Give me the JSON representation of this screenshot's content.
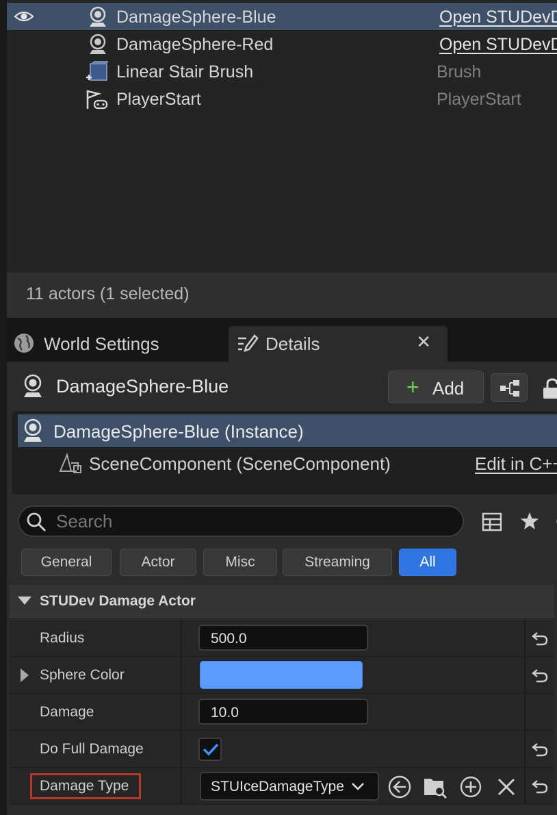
{
  "outliner": {
    "rows": [
      {
        "name": "DamageSphere-Blue",
        "type": "Open STUDevD",
        "selected": true,
        "visible": true
      },
      {
        "name": "DamageSphere-Red",
        "type": "Open STUDevD",
        "selected": false
      },
      {
        "name": "Linear Stair Brush",
        "type": "Brush",
        "selected": false
      },
      {
        "name": "PlayerStart",
        "type": "PlayerStart",
        "selected": false
      }
    ],
    "status": "11 actors (1 selected)"
  },
  "tabs": {
    "world_settings": "World Settings",
    "details": "Details",
    "close": "✕"
  },
  "details": {
    "actor_name": "DamageSphere-Blue",
    "add_label": "Add",
    "add_plus": "+",
    "components": {
      "instance": "DamageSphere-Blue (Instance)",
      "scene_component": "SceneComponent (SceneComponent)",
      "edit_link": "Edit in C++"
    },
    "search": {
      "placeholder": "Search"
    },
    "filters": [
      "General",
      "Actor",
      "Misc",
      "Streaming",
      "All"
    ],
    "active_filter": "All",
    "category": "STUDev Damage Actor",
    "properties": {
      "radius": {
        "label": "Radius",
        "value": "500.0"
      },
      "sphere_color": {
        "label": "Sphere Color",
        "color": "#5b9bff"
      },
      "damage": {
        "label": "Damage",
        "value": "10.0"
      },
      "do_full_damage": {
        "label": "Do Full Damage",
        "checked": true
      },
      "damage_type": {
        "label": "Damage Type",
        "value": "STUIceDamageType"
      }
    }
  },
  "colors": {
    "selection": "#3d5068",
    "accent": "#2f74e0",
    "add_green": "#6fcf4a",
    "highlight_box": "#b53a2a"
  }
}
